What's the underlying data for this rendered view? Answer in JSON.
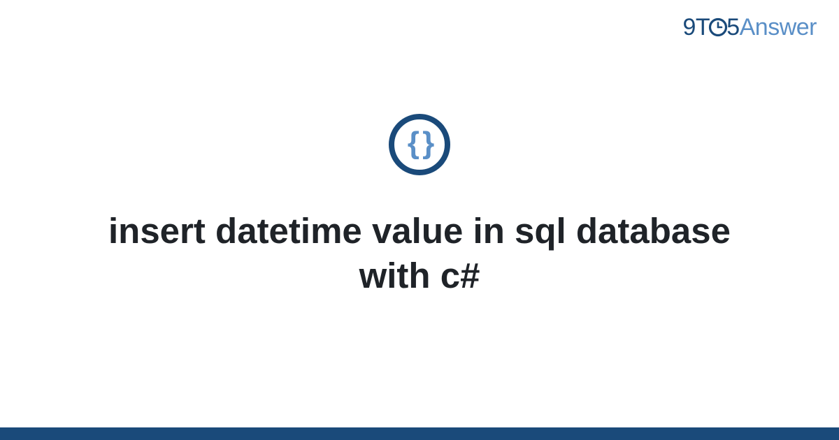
{
  "logo": {
    "part_nine": "9",
    "part_t": "T",
    "part_five": "5",
    "part_answer": "Answer"
  },
  "icon": {
    "name": "code-braces-icon",
    "glyph": "{ }"
  },
  "title": "insert datetime value in sql database with c#",
  "colors": {
    "primary": "#1a4a7a",
    "secondary": "#5a8fc7",
    "text": "#1f2328"
  }
}
